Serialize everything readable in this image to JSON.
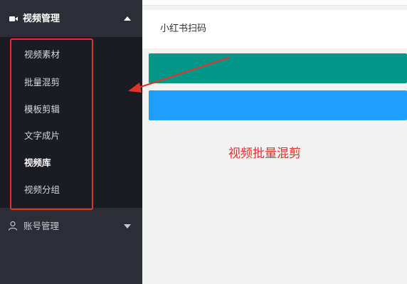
{
  "sidebar": {
    "group_title": "视频管理",
    "items": [
      {
        "label": "视频素材",
        "active": false
      },
      {
        "label": "批量混剪",
        "active": false
      },
      {
        "label": "模板剪辑",
        "active": false
      },
      {
        "label": "文字成片",
        "active": false
      },
      {
        "label": "视频库",
        "active": true
      },
      {
        "label": "视频分组",
        "active": false
      }
    ],
    "account_label": "账号管理"
  },
  "main": {
    "scan_label": "小红书扫码",
    "annotation": "视频批量混剪"
  },
  "colors": {
    "sidebar_bg": "#2b2e37",
    "submenu_bg": "#1b1c22",
    "green": "#009688",
    "blue": "#1e9fff",
    "annotation_red": "#e0342a"
  },
  "icons": {
    "group": "video-camera-icon",
    "account": "user-icon"
  }
}
